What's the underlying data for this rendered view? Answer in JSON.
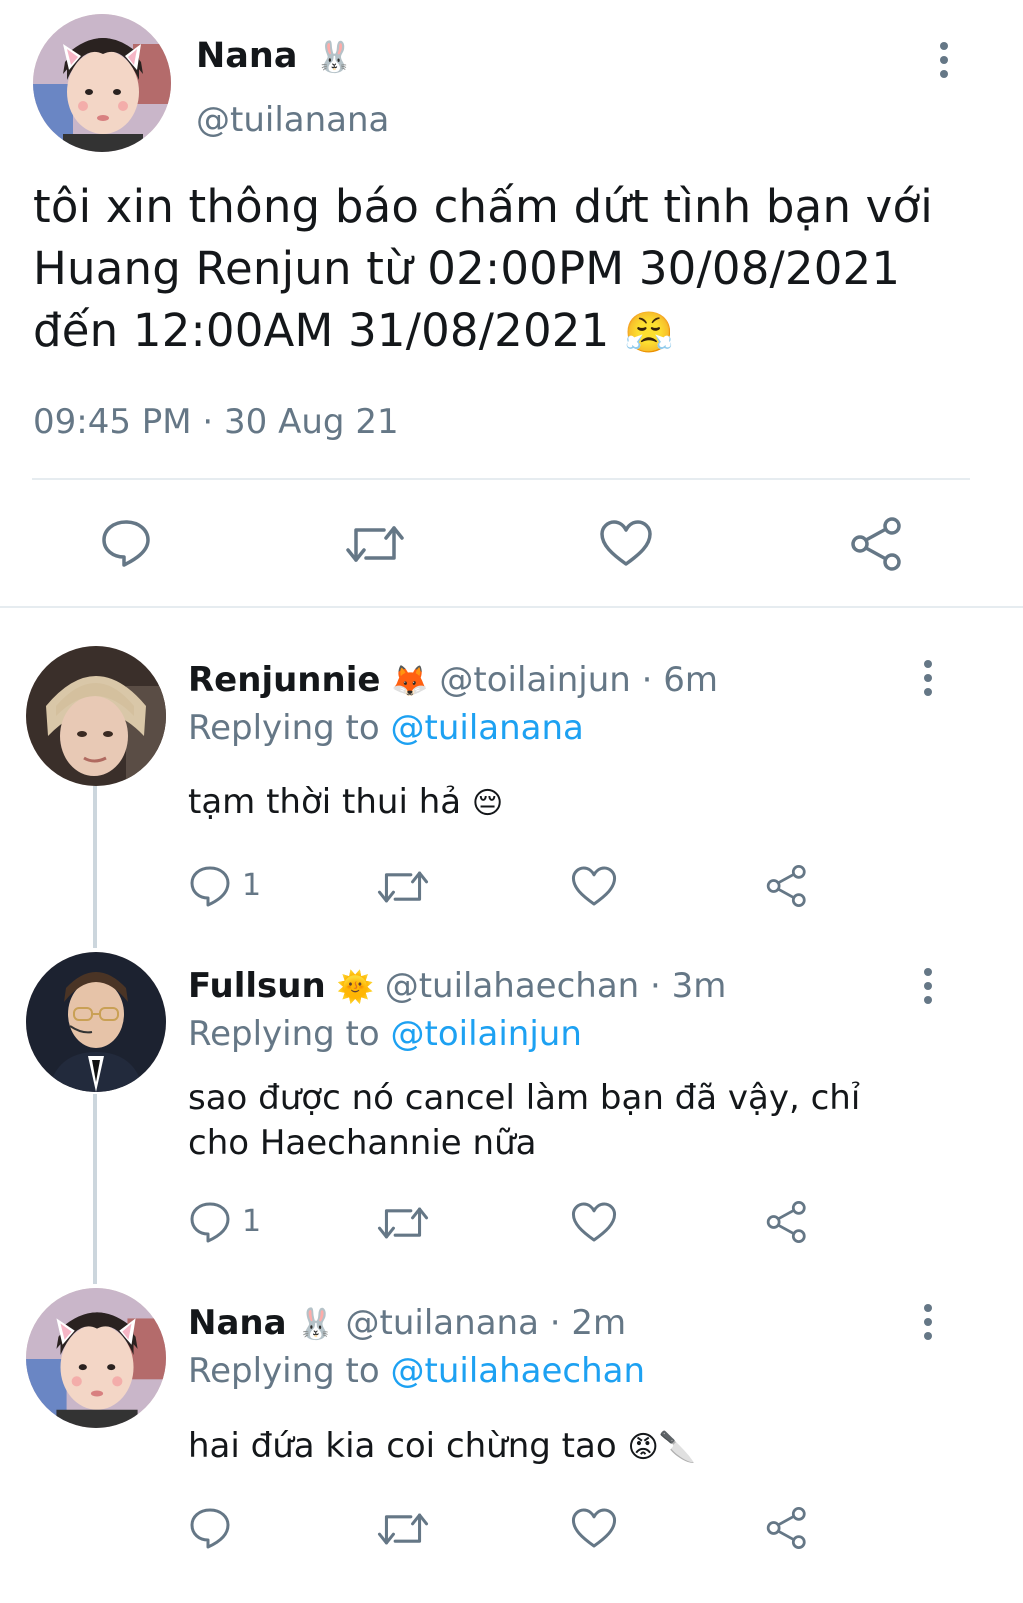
{
  "main_tweet": {
    "display_name": "Nana",
    "name_emoji": "🐰",
    "handle": "@tuilanana",
    "text_line1": "tôi xin thông báo chấm dứt tình bạn với",
    "text_line2": "Huang Renjun từ 02:00PM 30/08/2021",
    "text_line3": "đến 12:00AM 31/08/2021",
    "text_emoji": "😤",
    "timestamp": "09:45 PM · 30 Aug 21",
    "actions": [
      "reply-icon",
      "retweet-icon",
      "like-icon",
      "share-icon"
    ]
  },
  "replies": [
    {
      "display_name": "Renjunnie",
      "name_emoji": "🦊",
      "handle": "@toilainjun",
      "time": "· 6m",
      "replying_label": "Replying to",
      "replying_to": "@tuilanana",
      "text": "tạm thời thui hả",
      "text_emoji": "😔",
      "reply_count": "1"
    },
    {
      "display_name": "Fullsun",
      "name_emoji": "🌞",
      "handle": "@tuilahaechan",
      "time": "· 3m",
      "replying_label": "Replying to",
      "replying_to": "@toilainjun",
      "text_line1": "sao được nó cancel làm bạn đã vậy, chỉ",
      "text_line2": "cho Haechannie nữa",
      "reply_count": "1"
    },
    {
      "display_name": "Nana",
      "name_emoji": "🐰",
      "handle": "@tuilanana",
      "time": "· 2m",
      "replying_label": "Replying to",
      "replying_to": "@tuilahaechan",
      "text": "hai đứa kia coi chừng tao",
      "text_emoji": "😡🔪"
    }
  ],
  "colors": {
    "text": "#14171a",
    "secondary": "#657786",
    "link": "#1da1f2",
    "divider": "#e6ecf0",
    "thread_line": "#ccd6dd"
  }
}
